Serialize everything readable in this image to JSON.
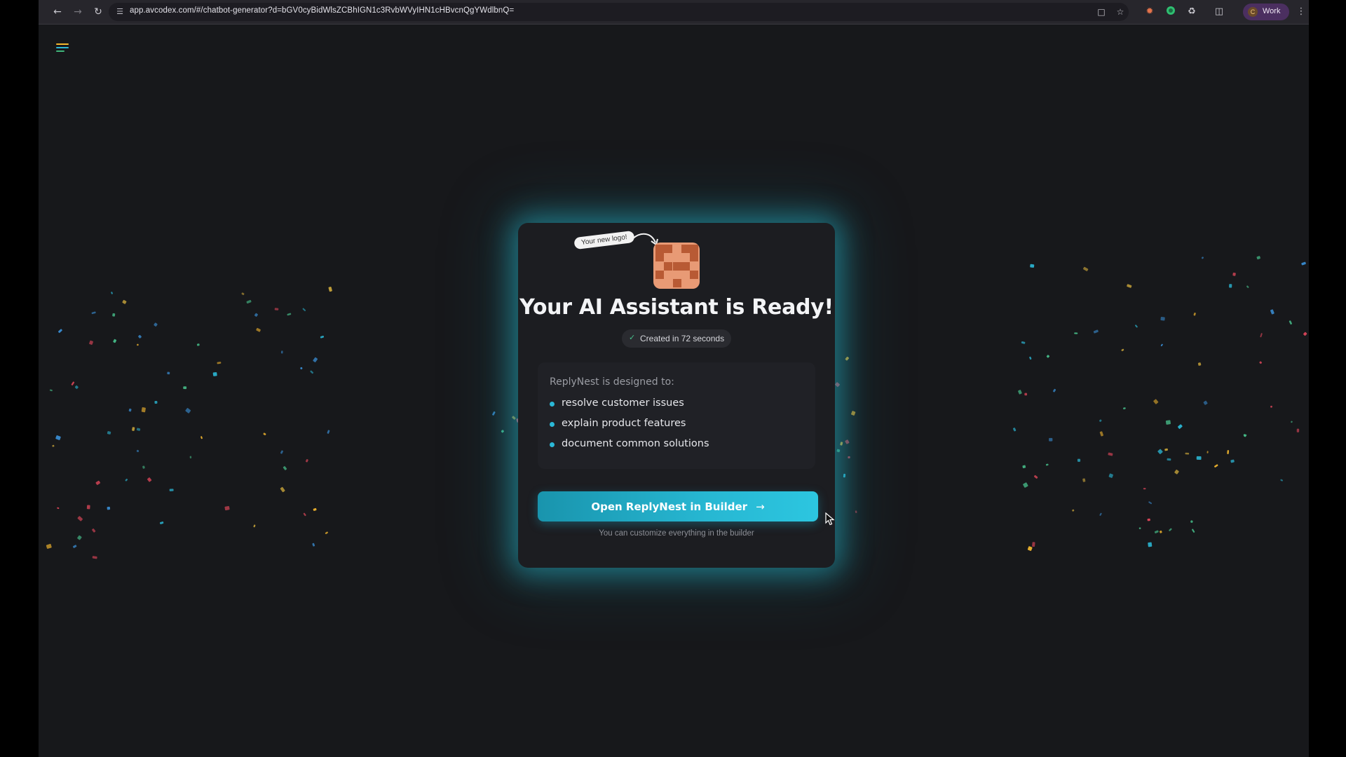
{
  "browser": {
    "url": "app.avcodex.com/#/chatbot-generator?d=bGV0cyBidWlsZCBhIGN1c3RvbWVyIHN1cHBvcnQgYWdlbnQ=",
    "profile_label": "Work",
    "profile_initial": "C",
    "icons": {
      "back": "back-arrow-icon",
      "forward": "forward-arrow-icon",
      "reload": "reload-icon",
      "site_info": "site-settings-icon",
      "install": "install-app-icon",
      "bookmark": "star-icon",
      "extension_1": "extension-sun-icon",
      "extension_2": "extension-circle-icon",
      "extensions": "puzzle-icon",
      "side_panel": "side-panel-icon",
      "menu": "kebab-menu-icon"
    }
  },
  "app": {
    "menu_icon": "menu-lines-icon",
    "menu_colors": [
      "#f5b82e",
      "#2bb8d6",
      "#3fb57a"
    ]
  },
  "card": {
    "logo_tag": "Your new logo!",
    "title": "Your AI Assistant is Ready!",
    "badge_text": "Created in 72 seconds",
    "info_heading": "ReplyNest is designed to:",
    "items": [
      "resolve customer issues",
      "explain product features",
      "document common solutions"
    ],
    "cta_label": "Open ReplyNest in Builder",
    "cta_note": "You can customize everything in the builder"
  },
  "colors": {
    "accent": "#27b7d2",
    "logo_bg": "#e89a75",
    "logo_cells": "#b85a34",
    "success": "#47c08b",
    "page_bg": "#17181b",
    "card_bg": "#1c1d21",
    "confetti": [
      "#e0475a",
      "#2bb8d6",
      "#f5b82e",
      "#47c08b",
      "#c9a53a",
      "#3a8fd6"
    ]
  }
}
